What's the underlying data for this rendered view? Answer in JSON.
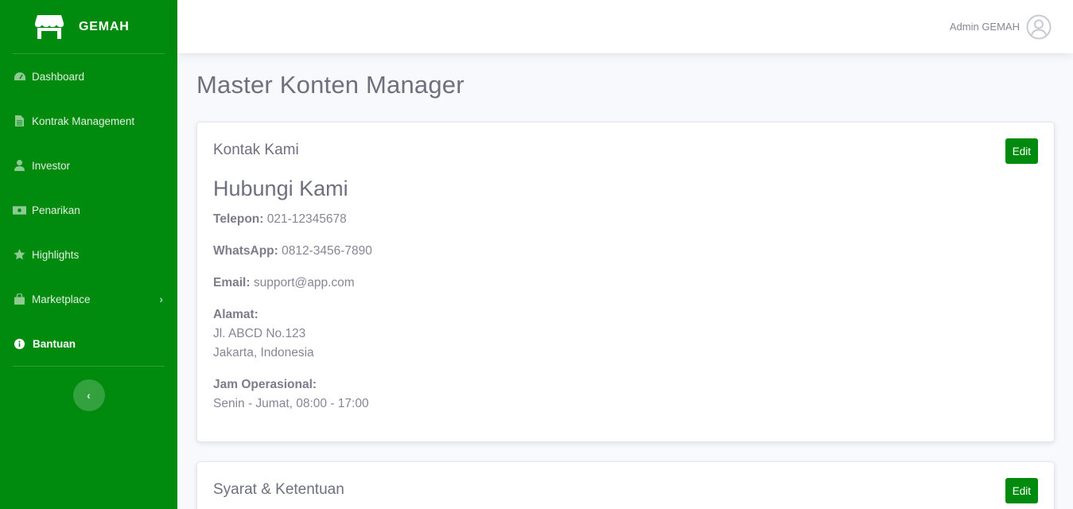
{
  "brand": {
    "name": "GEMAH"
  },
  "sidebar": {
    "items": [
      {
        "label": "Dashboard",
        "icon": "tachometer-icon"
      },
      {
        "label": "Kontrak Management",
        "icon": "file-icon"
      },
      {
        "label": "Investor",
        "icon": "user-icon"
      },
      {
        "label": "Penarikan",
        "icon": "money-bill-icon"
      },
      {
        "label": "Highlights",
        "icon": "star-icon"
      },
      {
        "label": "Marketplace",
        "icon": "shopping-bag-icon",
        "expandable": true
      },
      {
        "label": "Bantuan",
        "icon": "info-circle-icon",
        "active": true
      }
    ]
  },
  "topbar": {
    "user_name": "Admin GEMAH"
  },
  "page": {
    "title": "Master Konten Manager"
  },
  "contact_card": {
    "title": "Kontak Kami",
    "edit_label": "Edit",
    "heading": "Hubungi Kami",
    "phone_label": "Telepon:",
    "phone": "021-12345678",
    "whatsapp_label": "WhatsApp:",
    "whatsapp": "0812-3456-7890",
    "email_label": "Email:",
    "email": "support@app.com",
    "address_label": "Alamat:",
    "address_line1": "Jl. ABCD No.123",
    "address_line2": "Jakarta, Indonesia",
    "hours_label": "Jam Operasional:",
    "hours": "Senin - Jumat, 08:00 - 17:00"
  },
  "terms_card": {
    "title": "Syarat & Ketentuan",
    "edit_label": "Edit"
  },
  "colors": {
    "brand_green": "#008a0e",
    "page_bg": "#f8f9fc",
    "text_gray": "#858796"
  }
}
